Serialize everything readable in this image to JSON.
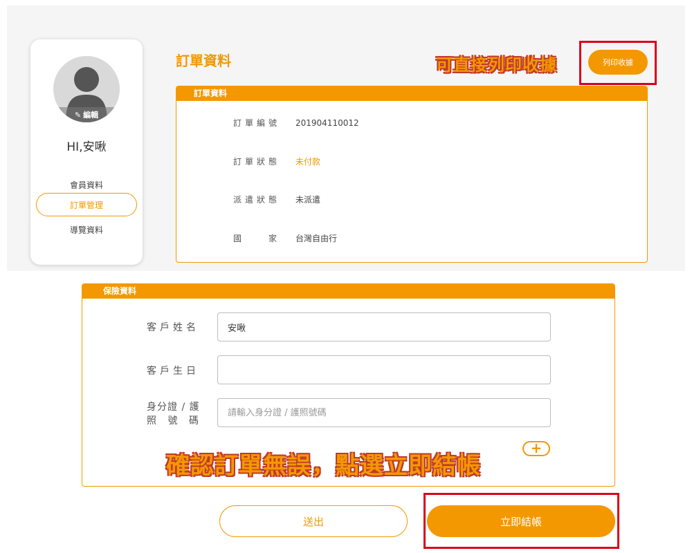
{
  "sidebar": {
    "edit_label": "編輯",
    "greeting": "HI,安啾",
    "items": [
      {
        "label": "會員資料",
        "active": false
      },
      {
        "label": "訂單管理",
        "active": true
      },
      {
        "label": "導覽資料",
        "active": false
      }
    ]
  },
  "order": {
    "title": "訂單資料",
    "print_button": "列印收據",
    "print_annotation": "可直接列印收據",
    "box_header": "訂單資料",
    "rows": [
      {
        "label": "訂單編號",
        "value": "201904110012"
      },
      {
        "label": "訂單狀態",
        "value": "未付款"
      },
      {
        "label": "派遣狀態",
        "value": "未派遣"
      },
      {
        "label": "國　　家",
        "value": "台灣自由行"
      }
    ]
  },
  "insurance": {
    "box_header": "保險資料",
    "name_label": "客戶姓名",
    "name_value": "安啾",
    "birthday_label": "客戶生日",
    "birthday_value": "",
    "id_label_line1": "身分證 / 護",
    "id_label_line2": "照 號 碼",
    "id_placeholder": "請輸入身分證 / 護照號碼",
    "add_icon": "plus-icon"
  },
  "annotation_checkout": "確認訂單無誤，點選立即結帳",
  "actions": {
    "submit_label": "送出",
    "checkout_label": "立即結帳"
  },
  "colors": {
    "accent": "#f39800",
    "highlight_frame": "#d9001b"
  }
}
